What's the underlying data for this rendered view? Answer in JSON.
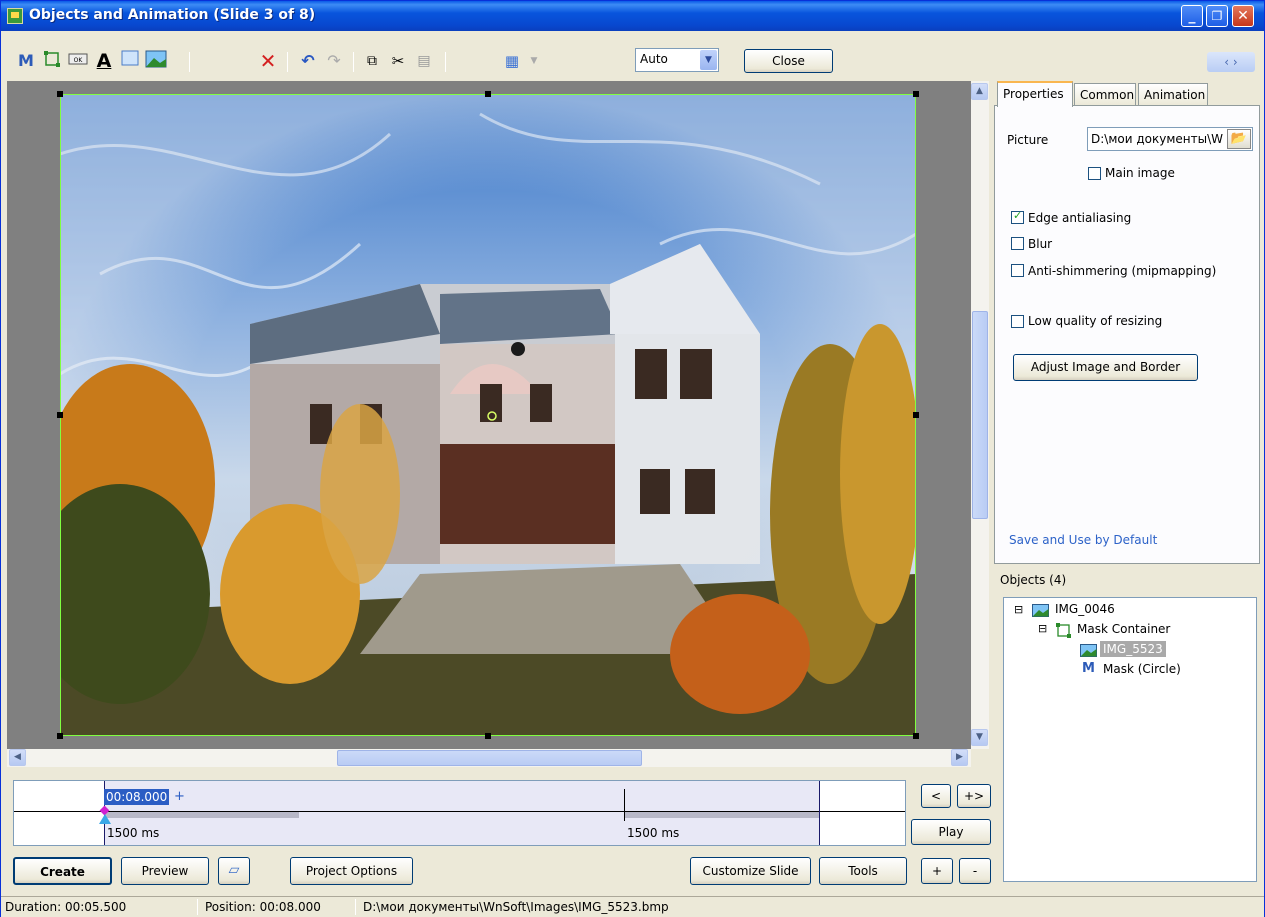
{
  "window": {
    "title": "Objects and Animation  (Slide 3 of 8)",
    "controls": {
      "minimize": "_",
      "maximize": "❐",
      "close": "✕"
    }
  },
  "toolbar": {
    "icons": [
      "mask-icon",
      "container-icon",
      "button-icon",
      "text-icon",
      "rectangle-icon",
      "image-icon",
      "delete-icon",
      "undo-icon",
      "redo-icon",
      "copy-icon",
      "cut-icon",
      "paste-icon",
      "grid-icon"
    ],
    "zoom_value": "Auto",
    "close_label": "Close",
    "nav_label": "‹ ›"
  },
  "properties": {
    "tabs": [
      "Properties",
      "Common",
      "Animation"
    ],
    "picture_label": "Picture",
    "picture_value": "D:\\мои документы\\W",
    "main_image_label": "Main image",
    "main_image_checked": false,
    "edge_antialiasing_label": "Edge antialiasing",
    "edge_antialiasing_checked": true,
    "blur_label": "Blur",
    "blur_checked": false,
    "anti_shimmering_label": "Anti-shimmering (mipmapping)",
    "anti_shimmering_checked": false,
    "low_quality_label": "Low quality of resizing",
    "low_quality_checked": false,
    "adjust_button": "Adjust Image and Border",
    "save_default_link": "Save and Use by Default"
  },
  "objects": {
    "header": "Objects (4)",
    "items": [
      {
        "label": "IMG_0046",
        "icon": "image-icon",
        "level": 0,
        "expander": "⊟"
      },
      {
        "label": "Mask Container",
        "icon": "container-icon",
        "level": 1,
        "expander": "⊟"
      },
      {
        "label": "IMG_5523",
        "icon": "image-icon",
        "level": 2,
        "selected": true
      },
      {
        "label": "Mask (Circle)",
        "icon": "mask-icon",
        "level": 2
      }
    ]
  },
  "timeline": {
    "current_time": "00:08.000",
    "plus": "+",
    "marker1_label": "1500 ms",
    "marker2_label": "1500 ms"
  },
  "timeline_buttons": {
    "prev": "<",
    "add": "+>",
    "play": "Play",
    "zoom_in": "+",
    "zoom_out": "-"
  },
  "bottom_buttons": {
    "create": "Create",
    "preview": "Preview",
    "project_options": "Project Options",
    "customize_slide": "Customize Slide",
    "tools": "Tools"
  },
  "status": {
    "duration": "Duration:  00:05.500",
    "position": "Position:  00:08.000",
    "path": "D:\\мои документы\\WnSoft\\Images\\IMG_5523.bmp"
  }
}
